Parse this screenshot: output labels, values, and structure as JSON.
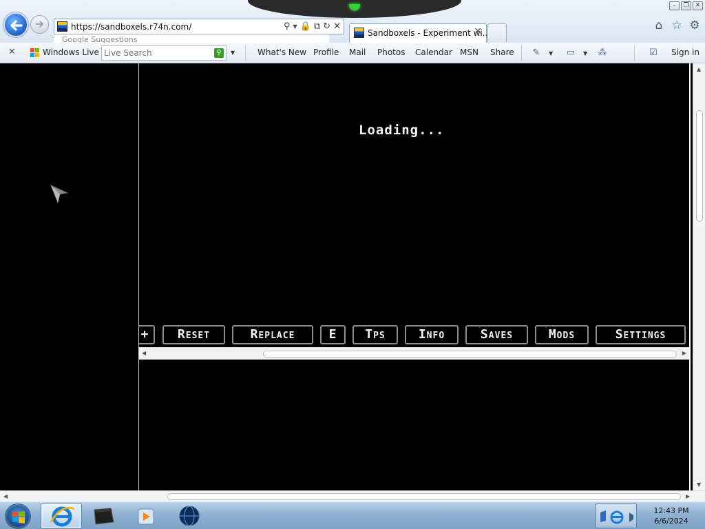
{
  "browser": {
    "url": "https://sandboxels.r74n.com/",
    "address_suggestion": "Google Suggestions",
    "tab_title": "Sandboxels - Experiment wi...",
    "command_bar": {
      "windows_live_label": "Windows Live",
      "search_placeholder": "Live Search",
      "links": [
        "What's New",
        "Profile",
        "Mail",
        "Photos",
        "Calendar",
        "MSN",
        "Share"
      ],
      "sign_in": "Sign in"
    }
  },
  "page": {
    "loading_text": "Loading...",
    "toolbar_buttons": [
      "+",
      "Reset",
      "Replace",
      "E",
      "Tps",
      "Info",
      "Saves",
      "Mods",
      "Settings"
    ]
  },
  "taskbar": {
    "time": "12:43 PM",
    "date": "6/6/2024"
  },
  "colors": {
    "page_bg": "#000000",
    "button_border": "#8d8d8d",
    "button_text": "#f5f5f5",
    "taskbar": "#8fb0d1"
  }
}
